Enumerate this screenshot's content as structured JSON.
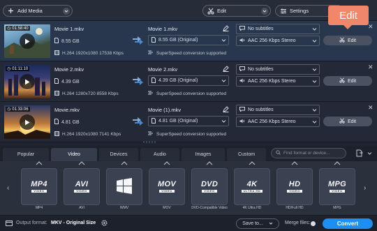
{
  "toolbar": {
    "add_media_label": "Add Media",
    "edit_label": "Edit",
    "settings_label": "Settings"
  },
  "callout": {
    "label": "Edit"
  },
  "files": [
    {
      "duration": "01:58:40",
      "source_name": "Movie 1.mkv",
      "source_size": "8.55 GB",
      "source_info": "H.264 1920x1080 17538 Kbps",
      "output_name": "Movie 1.mkv",
      "output_size": "8.55 GB (Original)",
      "superspeed": "SuperSpeed conversion supported",
      "subtitles": "No subtitles",
      "audio": "AAC 256 Kbps Stereo",
      "edit_label": "Edit",
      "selected": true
    },
    {
      "duration": "01:11:10",
      "source_name": "Movie 2.mkv",
      "source_size": "4.39 GB",
      "source_info": "H.264 1280x720 8558 Kbps",
      "output_name": "Movie 2.mkv",
      "output_size": "4.39 GB (Original)",
      "superspeed": "SuperSpeed conversion supported",
      "subtitles": "No subtitles",
      "audio": "AAC 256 Kbps Stereo",
      "edit_label": "Edit",
      "selected": false
    },
    {
      "duration": "01:33:06",
      "source_name": "Movie.mkv",
      "source_size": "4.81 GB",
      "source_info": "H.264 1920x1080 7141 Kbps",
      "output_name": "Movie (1).mkv",
      "output_size": "4.81 GB (Original)",
      "superspeed": "SuperSpeed conversion supported",
      "subtitles": "No subtitles",
      "audio": "AAC 256 Kbps Stereo",
      "edit_label": "Edit",
      "selected": false
    }
  ],
  "format_tabs": [
    "Popular",
    "Video",
    "Devices",
    "Audio",
    "Images",
    "Custom"
  ],
  "active_tab": "Video",
  "search_placeholder": "Find format or device...",
  "formats": [
    {
      "badge": "MP4",
      "sub": "VIDEO",
      "label": "MP4"
    },
    {
      "badge": "AVI",
      "sub": "VIDEO",
      "label": "AVI"
    },
    {
      "badge": "",
      "sub": "",
      "label": "WMV"
    },
    {
      "badge": "MOV",
      "sub": "VIDEO",
      "label": "MOV"
    },
    {
      "badge": "DVD",
      "sub": "VIDEO",
      "label": "DVD-Compatible Video"
    },
    {
      "badge": "4K",
      "sub": "ULTRA HD",
      "label": "4K Ultra HD"
    },
    {
      "badge": "HD",
      "sub": "VIDEO",
      "label": "HD/Full HD"
    },
    {
      "badge": "MPG",
      "sub": "VIDEO",
      "label": "MPG"
    }
  ],
  "status": {
    "output_format_label": "Output format:",
    "output_format_value": "MKV - Original Size",
    "save_to_label": "Save to...",
    "merge_files_label": "Merge files:",
    "convert_label": "Convert"
  },
  "colors": {
    "accent": "#1e8ef0",
    "callout": "#f0866a",
    "background": "#1e2430"
  }
}
